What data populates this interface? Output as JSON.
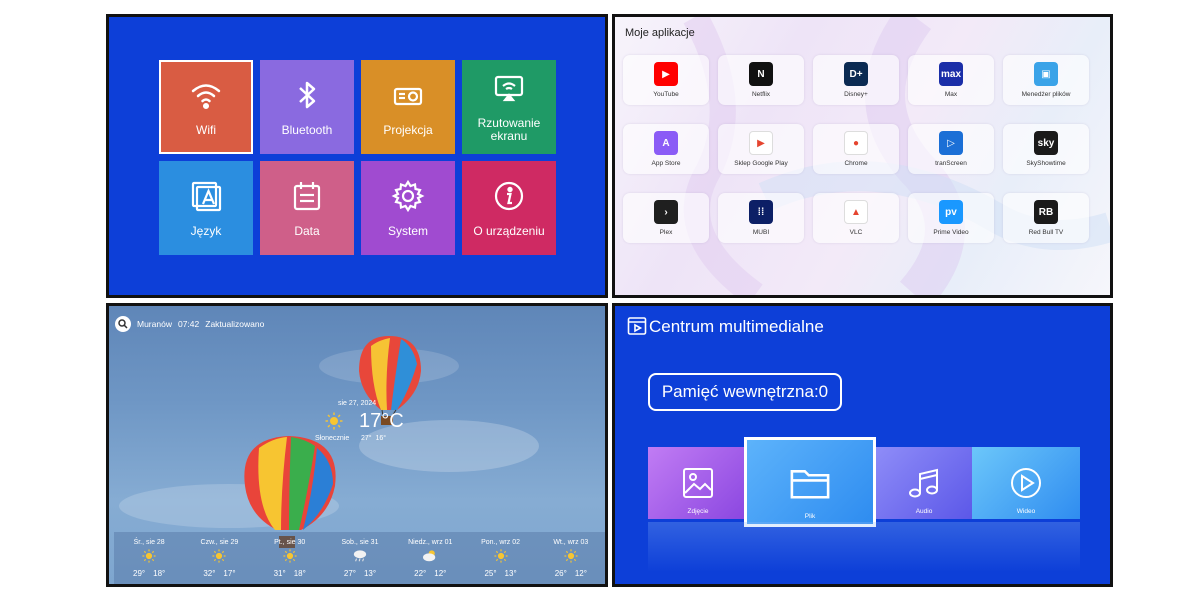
{
  "settings_menu": {
    "tiles": [
      {
        "label": "Wifi",
        "icon": "wifi-icon",
        "color": "#d95c43",
        "selected": true
      },
      {
        "label": "Bluetooth",
        "icon": "bluetooth-icon",
        "color": "#8a6ae0"
      },
      {
        "label": "Projekcja",
        "icon": "projector-icon",
        "color": "#d98f27"
      },
      {
        "label": "Rzutowanie ekranu",
        "icon": "screen-cast-icon",
        "color": "#1f9a66"
      },
      {
        "label": "Język",
        "icon": "language-icon",
        "color": "#2b8ee0"
      },
      {
        "label": "Data",
        "icon": "calendar-icon",
        "color": "#cf5f89"
      },
      {
        "label": "System",
        "icon": "gear-icon",
        "color": "#a04bd0"
      },
      {
        "label": "O urządzeniu",
        "icon": "info-icon",
        "color": "#cf2a63"
      }
    ]
  },
  "apps_screen": {
    "title": "Moje aplikacje",
    "apps": [
      {
        "name": "YouTube",
        "icon": "youtube-icon",
        "color": "#ff0000",
        "glyph": "▶"
      },
      {
        "name": "Netflix",
        "icon": "netflix-icon",
        "color": "#111111",
        "glyph": "N"
      },
      {
        "name": "Disney+",
        "icon": "disney-icon",
        "color": "#0b2a52",
        "glyph": "D+"
      },
      {
        "name": "Max",
        "icon": "max-icon",
        "color": "#1b2ea8",
        "glyph": "max"
      },
      {
        "name": "Menedżer plików",
        "icon": "file-manager-icon",
        "color": "#3aa3e8",
        "glyph": "▣"
      },
      {
        "name": "App Store",
        "icon": "app-store-icon",
        "color": "#8b5cf6",
        "glyph": "A"
      },
      {
        "name": "Sklep Google Play",
        "icon": "google-play-icon",
        "color": "#ffffff",
        "glyph": "▶"
      },
      {
        "name": "Chrome",
        "icon": "chrome-icon",
        "color": "#ffffff",
        "glyph": "●"
      },
      {
        "name": "tranScreen",
        "icon": "transcreen-icon",
        "color": "#1b6fd6",
        "glyph": "▷"
      },
      {
        "name": "SkyShowtime",
        "icon": "skyshowtime-icon",
        "color": "#1a1a1a",
        "glyph": "sky"
      },
      {
        "name": "Plex",
        "icon": "plex-icon",
        "color": "#1f1f1f",
        "glyph": "›"
      },
      {
        "name": "MUBI",
        "icon": "mubi-icon",
        "color": "#0c1f66",
        "glyph": "⁞⁞"
      },
      {
        "name": "VLC",
        "icon": "vlc-icon",
        "color": "#ffffff",
        "glyph": "▲"
      },
      {
        "name": "Prime Video",
        "icon": "prime-video-icon",
        "color": "#1a98ff",
        "glyph": "pv"
      },
      {
        "name": "Red Bull TV",
        "icon": "redbull-tv-icon",
        "color": "#1a1a1a",
        "glyph": "RB"
      }
    ]
  },
  "weather": {
    "location": "Muranów",
    "time": "07:42",
    "status": "Zaktualizowano",
    "date": "sie 27, 2024",
    "temperature": "17°C",
    "condition": "Słonecznie",
    "high_low": "27°  16°",
    "forecast": [
      {
        "day": "Śr., sie 28",
        "icon": "sun-icon",
        "high": "29°",
        "low": "18°"
      },
      {
        "day": "Czw., sie 29",
        "icon": "sun-icon",
        "high": "32°",
        "low": "17°"
      },
      {
        "day": "Pt., sie 30",
        "icon": "sun-icon",
        "high": "31°",
        "low": "18°"
      },
      {
        "day": "Sob., sie 31",
        "icon": "rain-cloud-icon",
        "high": "27°",
        "low": "13°"
      },
      {
        "day": "Niedz., wrz 01",
        "icon": "partly-cloudy-icon",
        "high": "22°",
        "low": "12°"
      },
      {
        "day": "Pon., wrz 02",
        "icon": "sun-icon",
        "high": "25°",
        "low": "13°"
      },
      {
        "day": "Wt., wrz 03",
        "icon": "sun-icon",
        "high": "26°",
        "low": "12°"
      }
    ]
  },
  "multimedia": {
    "title": "Centrum multimedialne",
    "storage": "Pamięć wewnętrzna:0",
    "categories": [
      {
        "label": "Zdjęcie",
        "icon": "image-icon",
        "color": "#a55ae8"
      },
      {
        "label": "Plik",
        "icon": "folder-icon",
        "color": "#3c97f5",
        "selected": true
      },
      {
        "label": "Audio",
        "icon": "music-icon",
        "color": "#6b6cf2"
      },
      {
        "label": "Wideo",
        "icon": "play-icon",
        "color": "#32a8f2"
      }
    ]
  }
}
